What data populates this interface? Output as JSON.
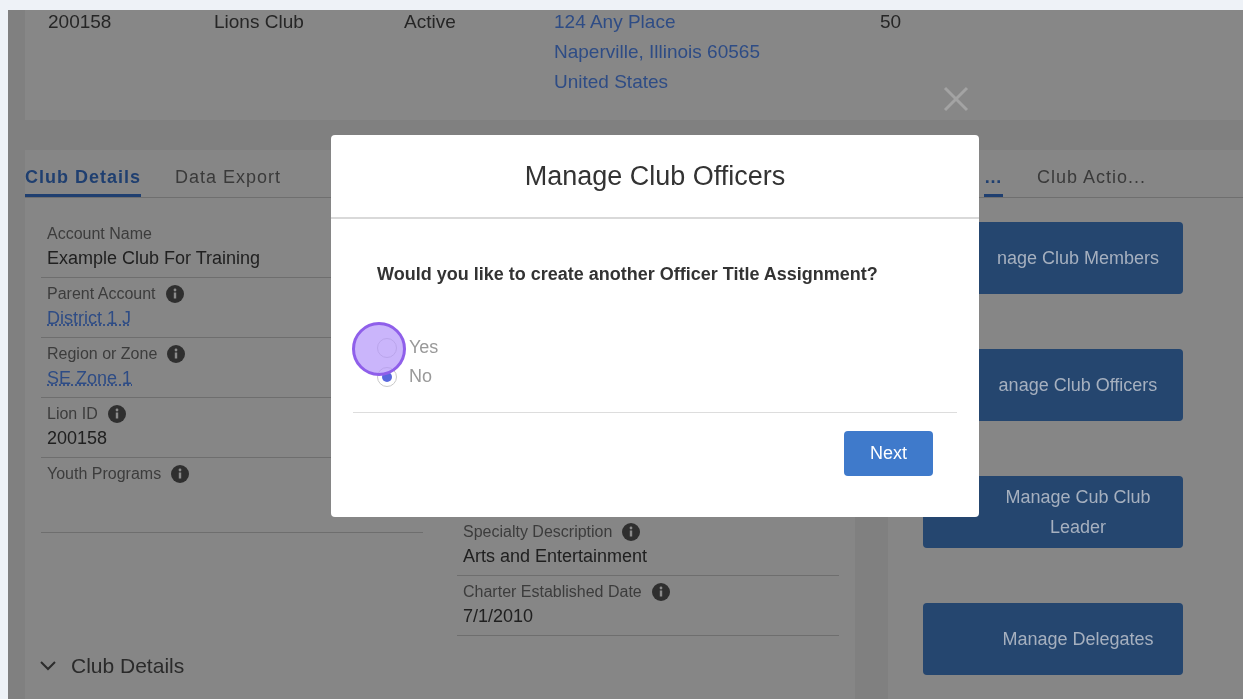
{
  "header_row": {
    "cells": [
      {
        "kind": "text",
        "text": "200158"
      },
      {
        "kind": "text",
        "text": "Lions Club"
      },
      {
        "kind": "text",
        "text": "Active"
      },
      {
        "kind": "address",
        "lines": [
          "124 Any Place",
          "Naperville, Illinois 60565",
          "United States"
        ]
      },
      {
        "kind": "text",
        "text": "50"
      }
    ]
  },
  "tabs": [
    {
      "label": "Club Details",
      "selected": true
    },
    {
      "label": "Data Export",
      "selected": false
    }
  ],
  "fields_left": [
    {
      "label": "Account Name",
      "info": false,
      "value": "Example Club For Training",
      "link": false
    },
    {
      "label": "Parent Account",
      "info": true,
      "value": "District 1 J",
      "link": true
    },
    {
      "label": "Region or Zone",
      "info": true,
      "value": "SE Zone 1",
      "link": true
    },
    {
      "label": "Lion ID",
      "info": true,
      "value": "200158",
      "link": false
    },
    {
      "label": "Youth Programs",
      "info": true
    }
  ],
  "fields_middle": [
    {
      "label": "Specialty Description",
      "info": true,
      "value": "Arts and Entertainment",
      "link": false
    },
    {
      "label": "Charter Established Date",
      "info": true,
      "value": "7/1/2010",
      "link": false
    }
  ],
  "section": {
    "title": "Club Details",
    "expanded": true
  },
  "side_tabs": [
    {
      "label": "…",
      "selected": true
    },
    {
      "label": "Club Actio...",
      "selected": false
    }
  ],
  "action_buttons": [
    "nage Club Members",
    "anage Club Officers",
    "Manage Cub Club Leader",
    "Manage Delegates"
  ],
  "dialog": {
    "title": "Manage Club Officers",
    "question": "Would you like to create another Officer Title Assignment?",
    "options": [
      {
        "label": "Yes",
        "selected": false
      },
      {
        "label": "No",
        "selected": true
      }
    ],
    "button": "Next"
  }
}
